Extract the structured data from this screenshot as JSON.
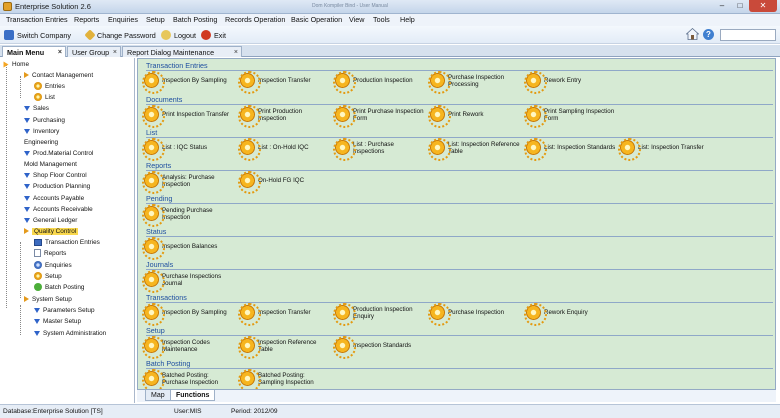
{
  "window": {
    "title": "Enterprise Solution  2.6",
    "faint_caption": "Dom Kompiler Bind - User Manual"
  },
  "menu": [
    "Transaction Entries",
    "Reports",
    "Enquiries",
    "Setup",
    "Batch Posting",
    "Records Operation",
    "Basic Operation",
    "View",
    "Tools",
    "Help"
  ],
  "toolbar": {
    "switch_company": "Switch Company",
    "change_password": "Change Password",
    "logout": "Logout",
    "exit": "Exit",
    "search_value": ""
  },
  "tabs": [
    "Main Menu",
    "User Group",
    "Report Dialog Maintenance"
  ],
  "tree": {
    "home": "Home",
    "contact_management": "Contact Management",
    "entries": "Entries",
    "list": "List",
    "sales": "Sales",
    "purchasing": "Purchasing",
    "inventory": "Inventory",
    "engineering": "Engineering",
    "prod_material_control": "Prod.Material Control",
    "mold_management": "Mold Management",
    "shop_floor_control": "Shop Floor Control",
    "production_planning": "Production Planning",
    "accounts_payable": "Accounts Payable",
    "accounts_receivable": "Accounts Receivable",
    "general_ledger": "General Ledger",
    "quality_control": "Quality Control",
    "qc_transaction_entries": "Transaction Entries",
    "qc_reports": "Reports",
    "qc_enquiries": "Enquiries",
    "qc_setup": "Setup",
    "qc_batch_posting": "Batch Posting",
    "system_setup": "System Setup",
    "parameters_setup": "Parameters Setup",
    "master_setup": "Master Setup",
    "system_administration": "System Administration"
  },
  "sections": [
    {
      "title": "Transaction Entries",
      "items": [
        "Inspection By Sampling",
        "Inspection Transfer",
        "Production Inspection",
        "Purchase Inspection\nProcessing",
        "Rework Entry"
      ]
    },
    {
      "title": "Documents",
      "items": [
        "Print Inspection Transfer",
        "Print Production\nInspection",
        "Print Purchase Inspection\nForm",
        "Print Rework",
        "Print Sampling Inspection\nForm"
      ]
    },
    {
      "title": "List",
      "items": [
        "List : IQC Status",
        "List : On-Hold IQC",
        "List : Purchase\nInspections",
        "List: Inspection Reference\nTable",
        "List: Inspection Standards",
        "List: Inspection Transfer"
      ]
    },
    {
      "title": "Reports",
      "items": [
        "Analysis: Purchase\nInspection",
        "On-Hold FG IQC"
      ]
    },
    {
      "title": "Pending",
      "items": [
        "Pending Purchase\nInspection"
      ]
    },
    {
      "title": "Status",
      "items": [
        "Inspection Balances"
      ]
    },
    {
      "title": "Journals",
      "items": [
        "Purchase Inspections\nJournal"
      ]
    },
    {
      "title": "Transactions",
      "items": [
        "Inspection By Sampling",
        "Inspection Transfer",
        "Production Inspection\nEnquiry",
        "Purchase Inspection",
        "Rework Enquiry"
      ]
    },
    {
      "title": "Setup",
      "items": [
        "Inspection Codes\nMaintenance",
        "Inspection Reference\nTable",
        "Inspection Standards"
      ]
    },
    {
      "title": "Batch Posting",
      "items": [
        "Batched Posting:\nPurchase Inspection",
        "Batched Posting:\nSampling Inspection"
      ]
    }
  ],
  "bottom_tabs": [
    "Map",
    "Functions"
  ],
  "status": {
    "database": "Database:Enterprise Solution [TS]",
    "user": "User:MIS",
    "period": "Period:  2012/09"
  }
}
